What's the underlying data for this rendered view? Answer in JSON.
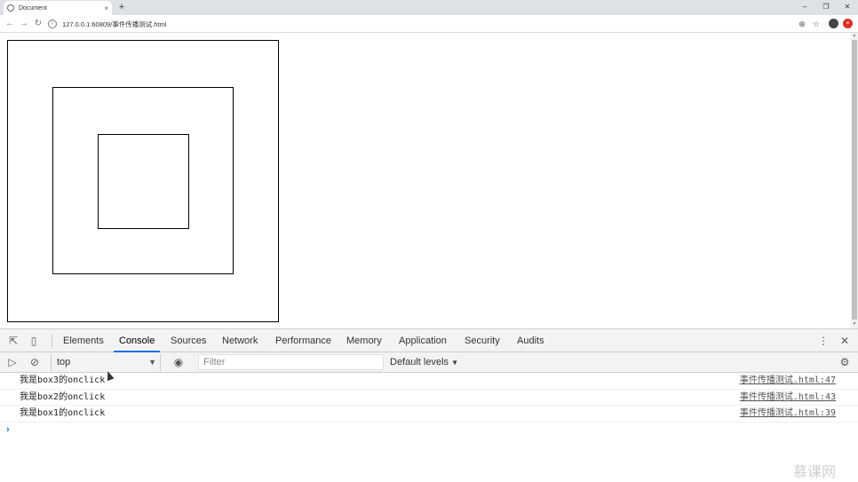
{
  "browser": {
    "tab_title": "Document",
    "tab_close": "×",
    "new_tab": "+",
    "url": "127.0.0.1:60809/事件传播测试.html",
    "info_icon": "i",
    "window_controls": [
      "–",
      "❐",
      "✕"
    ],
    "zoom_icon": "⊕",
    "star_icon": "☆",
    "extension_label": "×"
  },
  "devtools": {
    "tabs": [
      "Elements",
      "Console",
      "Sources",
      "Network",
      "Performance",
      "Memory",
      "Application",
      "Security",
      "Audits"
    ],
    "active_tab": "Console",
    "context": "top",
    "filter_placeholder": "Filter",
    "levels": "Default levels",
    "levels_caret": "▼",
    "context_caret": "▼",
    "prompt": "›",
    "menu_icon": "⋮",
    "close_icon": "✕",
    "settings_icon": "⚙"
  },
  "console": {
    "rows": [
      {
        "msg": "我是box3的onclick",
        "src": "事件传播测试.html:47"
      },
      {
        "msg": "我是box2的onclick",
        "src": "事件传播测试.html:43"
      },
      {
        "msg": "我是box1的onclick",
        "src": "事件传播测试.html:39"
      }
    ]
  },
  "watermark": "慕课网"
}
